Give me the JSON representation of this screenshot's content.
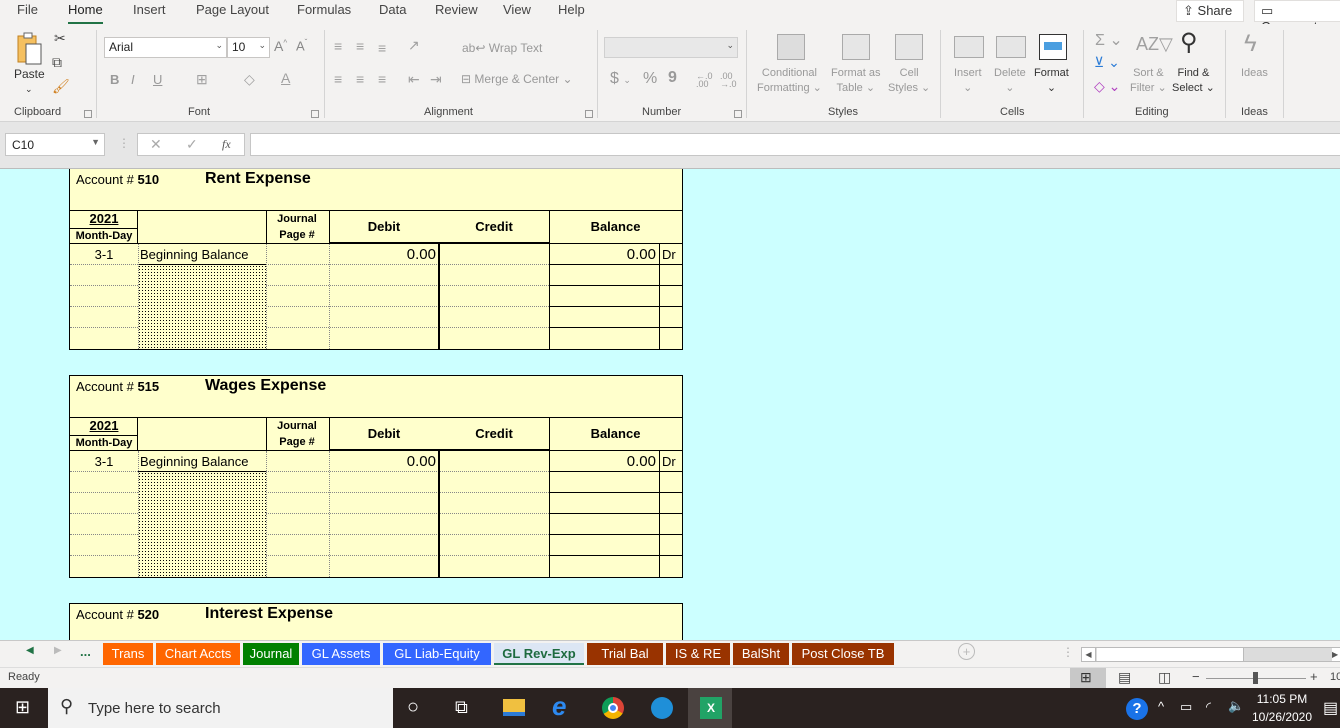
{
  "menu": {
    "tabs": [
      "File",
      "Home",
      "Insert",
      "Page Layout",
      "Formulas",
      "Data",
      "Review",
      "View",
      "Help"
    ],
    "active": "Home",
    "share": "Share",
    "comments": "Comments"
  },
  "ribbon": {
    "clipboard": {
      "paste": "Paste",
      "label": "Clipboard"
    },
    "font": {
      "name": "Arial",
      "size": "10",
      "bold": "B",
      "italic": "I",
      "underline": "U",
      "grow": "A^",
      "shrink": "Aˇ",
      "label": "Font"
    },
    "alignment": {
      "wrap_text": "Wrap Text",
      "merge_center": "Merge & Center",
      "label": "Alignment"
    },
    "number": {
      "format": "",
      "currency": "$",
      "percent": "%",
      "comma": "9",
      "label": "Number"
    },
    "styles": {
      "conditional": [
        "Conditional",
        "Formatting"
      ],
      "format_table": [
        "Format as",
        "Table"
      ],
      "cell_styles": [
        "Cell",
        "Styles"
      ],
      "label": "Styles"
    },
    "cells": {
      "insert": "Insert",
      "delete": "Delete",
      "format": "Format",
      "label": "Cells"
    },
    "editing": {
      "sort_filter": [
        "Sort &",
        "Filter"
      ],
      "find_select": [
        "Find &",
        "Select"
      ],
      "label": "Editing"
    },
    "ideas": {
      "ideas": "Ideas",
      "label": "Ideas"
    }
  },
  "formula_bar": {
    "name_box": "C10",
    "fx": "fx",
    "value": ""
  },
  "sheet": {
    "headers": {
      "year": "2021",
      "month_day": "Month-Day",
      "journal": "Journal",
      "page": "Page #",
      "debit": "Debit",
      "credit": "Credit",
      "balance": "Balance"
    },
    "accounts": [
      {
        "prefix": "Account #",
        "number": "510",
        "name": "Rent Expense",
        "row": {
          "date": "3-1",
          "desc": "Beginning Balance",
          "debit": "0.00",
          "balance": "0.00",
          "side": "Dr"
        }
      },
      {
        "prefix": "Account #",
        "number": "515",
        "name": "Wages Expense",
        "row": {
          "date": "3-1",
          "desc": "Beginning Balance",
          "debit": "0.00",
          "balance": "0.00",
          "side": "Dr"
        }
      },
      {
        "prefix": "Account #",
        "number": "520",
        "name": "Interest Expense"
      }
    ]
  },
  "sheet_tabs": [
    {
      "label": "Trans",
      "color": "#ff6600"
    },
    {
      "label": "Chart Accts",
      "color": "#ff6600"
    },
    {
      "label": "Journal",
      "color": "#008000"
    },
    {
      "label": "GL Assets",
      "color": "#3366ff"
    },
    {
      "label": "GL Liab-Equity",
      "color": "#3366ff"
    },
    {
      "label": "GL Rev-Exp",
      "color": "#3366ff",
      "active": true
    },
    {
      "label": "Trial Bal",
      "color": "#993300"
    },
    {
      "label": "IS & RE",
      "color": "#993300"
    },
    {
      "label": "BalSht",
      "color": "#993300"
    },
    {
      "label": "Post Close TB",
      "color": "#993300"
    }
  ],
  "tab_overflow": "...",
  "status": {
    "text": "Ready",
    "zoom": "10"
  },
  "taskbar": {
    "search_placeholder": "Type here to search",
    "time": "11:05 PM",
    "date": "10/26/2020"
  }
}
